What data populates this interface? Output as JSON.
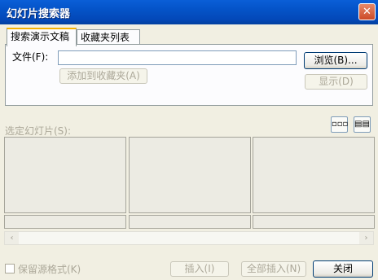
{
  "window": {
    "title": "幻灯片搜索器",
    "close_glyph": "✕"
  },
  "tabs": [
    {
      "label": "搜索演示文稿",
      "active": true
    },
    {
      "label": "收藏夹列表",
      "active": false
    }
  ],
  "search_panel": {
    "file_label": "文件(F):",
    "file_value": "",
    "browse_button": "浏览(B)...",
    "add_favorite_button": "添加到收藏夹(A)",
    "show_button": "显示(D)"
  },
  "slides_section": {
    "label": "选定幻灯片(S):",
    "view_icons": [
      "slide-view-icon",
      "list-view-icon"
    ],
    "slide_count_visible": 3
  },
  "bottom": {
    "keep_format_label": "保留源格式(K)",
    "keep_format_checked": false,
    "insert_button": "插入(I)",
    "insert_all_button": "全部插入(N)",
    "close_button": "关闭"
  },
  "scrollbar": {
    "left_arrow": "‹",
    "right_arrow": "›"
  }
}
